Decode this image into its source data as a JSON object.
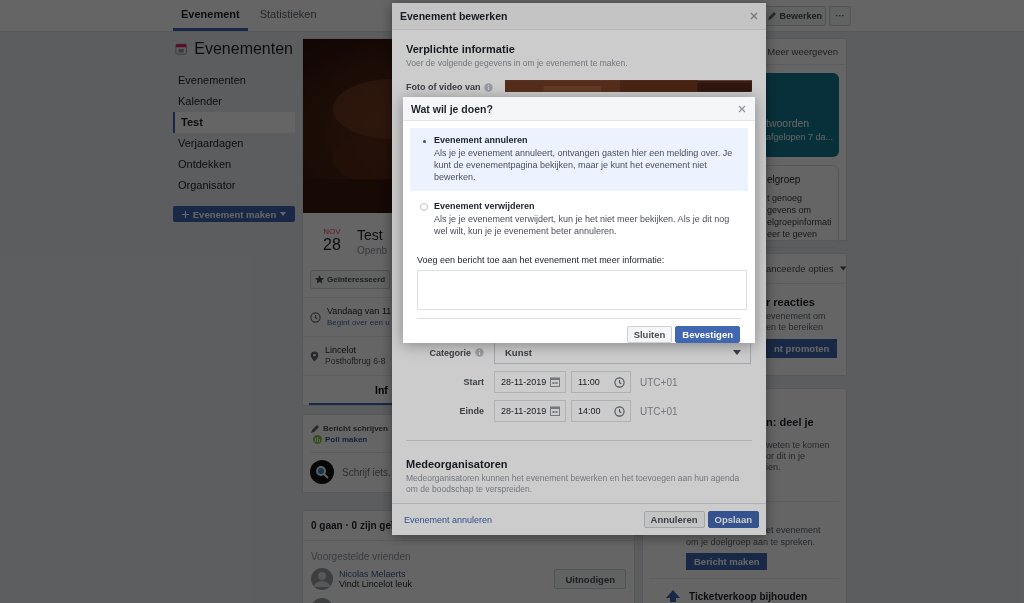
{
  "top_bar": {
    "tabs": [
      {
        "label": "Evenement",
        "selected": true
      },
      {
        "label": "Statistieken",
        "selected": false
      }
    ],
    "actions": [
      {
        "kind": "edit",
        "label": "Bewerken"
      },
      {
        "kind": "more",
        "label": "···"
      }
    ]
  },
  "sidebar": {
    "title": "Evenementen",
    "items": [
      {
        "label": "Evenementen",
        "selected": false
      },
      {
        "label": "Kalender",
        "selected": false
      },
      {
        "label": "Test",
        "selected": true
      },
      {
        "label": "Verjaardagen",
        "selected": false
      },
      {
        "label": "Ontdekken",
        "selected": false
      },
      {
        "label": "Organisator",
        "selected": false
      }
    ],
    "create_button": "Evenement maken"
  },
  "event": {
    "month": "NOV",
    "day": "28",
    "title": "Test",
    "privacy": "Openb",
    "interested_button": "Geïnteresseerd",
    "time": "Vandaag van 11",
    "time_note": "Begint over een u",
    "place": "Lincelot",
    "address": "Posthofbrug 6-8",
    "tab": {
      "label": "Inf",
      "selected": true
    }
  },
  "composer": {
    "actions": [
      {
        "kind": "write",
        "label": "Bericht schrijven"
      },
      {
        "kind": "poll",
        "label": "Poll maken"
      }
    ],
    "placeholder": "Schrijf iets."
  },
  "guests": {
    "summary": "0 gaan · 0 zijn geï",
    "suggested_title": "Voorgestelde vrienden",
    "friends": [
      {
        "name": "Nicolas Melaerts",
        "note": "Vindt Lincelot leuk",
        "button": "Uitnodigen"
      }
    ]
  },
  "right_column": {
    "link": "Meer weergeven",
    "insight_card": [
      "twoorden",
      "afgelopen 7 da..."
    ],
    "audience_card": [
      "elgroep",
      "t genoeg",
      "gevens om",
      "elgroepinformati",
      "eer te geven"
    ],
    "promote_card": {
      "menu": "anceerde opties",
      "title": "r reacties",
      "lines": [
        "evenement om",
        "en te bereiken"
      ],
      "button": "nt promoten"
    },
    "share_card": {
      "title": "n: deel je",
      "lines": [
        "weten te komen",
        "or dit in je",
        "ien."
      ],
      "post_lines": [
        "et evenement",
        "om je doelgroep aan te spreken."
      ],
      "button": "Bericht maken",
      "ticket": "Ticketverkoop bijhouden"
    }
  },
  "edit_dialog": {
    "title": "Evenement bewerken",
    "section_title": "Verplichte informatie",
    "section_hint": "Voer de volgende gegevens in om je evenement te maken.",
    "photo_label": "Foto of video van",
    "category_label": "Categorie",
    "category": "Kunst",
    "times": [
      {
        "label": "Start",
        "date": "28-11-2019",
        "time": "11:00",
        "zone": "UTC+01"
      },
      {
        "label": "Einde",
        "date": "28-11-2019",
        "time": "14:00",
        "zone": "UTC+01"
      }
    ],
    "cohosts_title": "Medeorganisatoren",
    "cohosts_hint": "Medeorganisatoren kunnen het evenement bewerken en het toevoegen aan hun agenda om de boodschap te verspreiden.",
    "cancel_link": "Evenement annuleren",
    "buttons": [
      {
        "kind": "secondary",
        "label": "Annuleren"
      },
      {
        "kind": "primary",
        "label": "Opslaan"
      }
    ]
  },
  "confirm_dialog": {
    "title": "Wat wil je doen?",
    "options": [
      {
        "title": "Evenement annuleren",
        "description": "Als je je evenement annuleert, ontvangen gasten hier een melding over. Je kunt de evenementpagina bekijken, maar je kunt het evenement niet bewerken.",
        "selected": true
      },
      {
        "title": "Evenement verwijderen",
        "description": "Als je je evenement verwijdert, kun je het niet meer bekijken. Als je dit nog wel wilt, kun je je evenement beter annuleren.",
        "selected": false
      }
    ],
    "message_label": "Voeg een bericht toe aan het evenement met meer informatie:",
    "buttons": [
      {
        "kind": "secondary",
        "label": "Sluiten"
      },
      {
        "kind": "primary",
        "label": "Bevestigen"
      }
    ]
  }
}
